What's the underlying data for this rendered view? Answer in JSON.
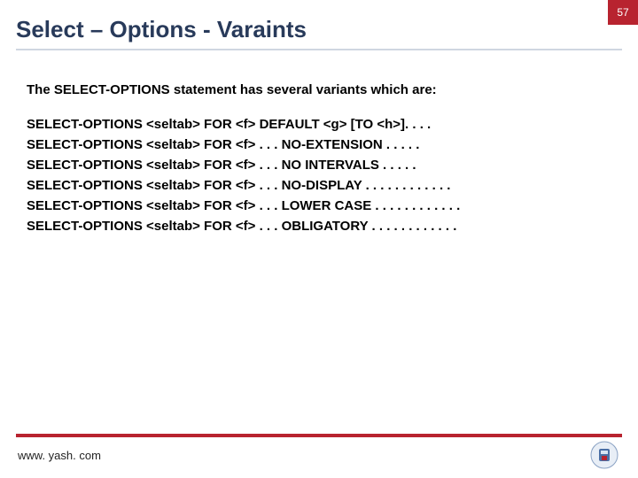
{
  "page_number": "57",
  "title": "Select – Options - Varaints",
  "intro": "The SELECT-OPTIONS statement has several variants which are:",
  "variants": [
    "SELECT-OPTIONS <seltab> FOR <f> DEFAULT <g> [TO <h>]. . . .",
    "SELECT-OPTIONS <seltab> FOR <f> . . . NO-EXTENSION . . . . .",
    "SELECT-OPTIONS <seltab> FOR <f> . . . NO INTERVALS . . . . .",
    "SELECT-OPTIONS <seltab> FOR <f> . . . NO-DISPLAY . . . . . . . . . . . .",
    "SELECT-OPTIONS <seltab> FOR <f> . . . LOWER CASE . . . . . . . . . . . .",
    "SELECT-OPTIONS <seltab> FOR <f> . . . OBLIGATORY . . . . . . . . . . . ."
  ],
  "footer_url": "www. yash. com"
}
